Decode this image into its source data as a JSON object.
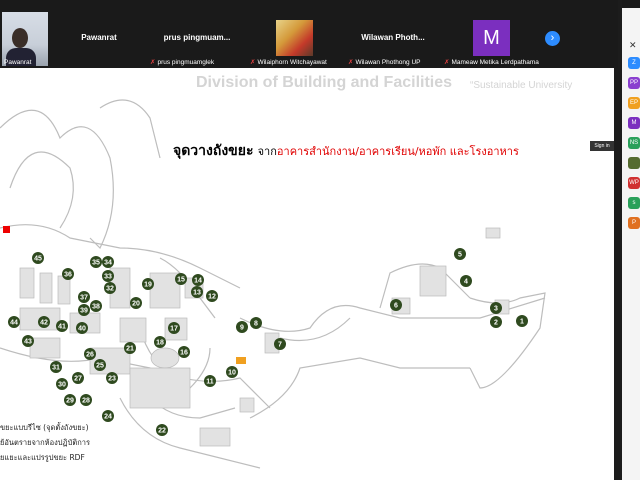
{
  "participants": [
    {
      "big_name": "",
      "small_name": "Pawanrat",
      "muted": false
    },
    {
      "big_name": "Pawanrat",
      "small_name": "prus pingmuamglek",
      "muted": true
    },
    {
      "big_name": "prus  pingmuam...",
      "small_name": "",
      "muted": false
    },
    {
      "big_name": "",
      "small_name": "Wilaiphorn Witchayawat",
      "muted": true
    },
    {
      "big_name": "Wilawan  Photh...",
      "small_name": "Wilawan Phothong UP",
      "muted": true
    },
    {
      "big_name": "",
      "small_name": "Mameaw Metika Lerdpathama",
      "muted": true
    }
  ],
  "avatar_letter": "M",
  "next_icon": "chevron-right-icon",
  "slide": {
    "title": "Division of Building and Facilities",
    "subtitle": "“Sustainable University",
    "heading_main": "จุดวางถังขยะ",
    "heading_jak": "จาก",
    "heading_red": "อาคารสำนักงาน/อาคารเรียน/หอพัก และโรงอาหาร",
    "signin": "Sign in",
    "legend": [
      "ขยะแบบรีไซ (จุดตั้งถังขยะ)",
      "ย้อันตรายจากห้องปฏิบัติการ",
      "ยแยะและแปรรูปขยะ RDF"
    ],
    "markers": [
      "45",
      "36",
      "35",
      "34",
      "33",
      "32",
      "19",
      "15",
      "14",
      "13",
      "12",
      "37",
      "38",
      "39",
      "20",
      "40",
      "41",
      "42",
      "44",
      "43",
      "17",
      "18",
      "16",
      "21",
      "26",
      "25",
      "23",
      "31",
      "30",
      "27",
      "29",
      "28",
      "24",
      "22",
      "11",
      "10",
      "9",
      "8",
      "7",
      "6",
      "5",
      "4",
      "3",
      "2",
      "1"
    ]
  },
  "side_badges": [
    {
      "label": "Z",
      "color": "#2d8cff"
    },
    {
      "label": "PP",
      "color": "#8a3fcf"
    },
    {
      "label": "EP",
      "color": "#f0a020"
    },
    {
      "label": "M",
      "color": "#7b2fbf"
    },
    {
      "label": "NS",
      "color": "#2aa05a"
    },
    {
      "label": "",
      "color": "#556b2f"
    },
    {
      "label": "WP",
      "color": "#d03030"
    },
    {
      "label": "s",
      "color": "#2aa05a"
    },
    {
      "label": "P",
      "color": "#e07020"
    }
  ],
  "colors": {
    "marker": "#2f4a1f",
    "heading_red": "#e00000",
    "accent": "#2d8cff"
  }
}
